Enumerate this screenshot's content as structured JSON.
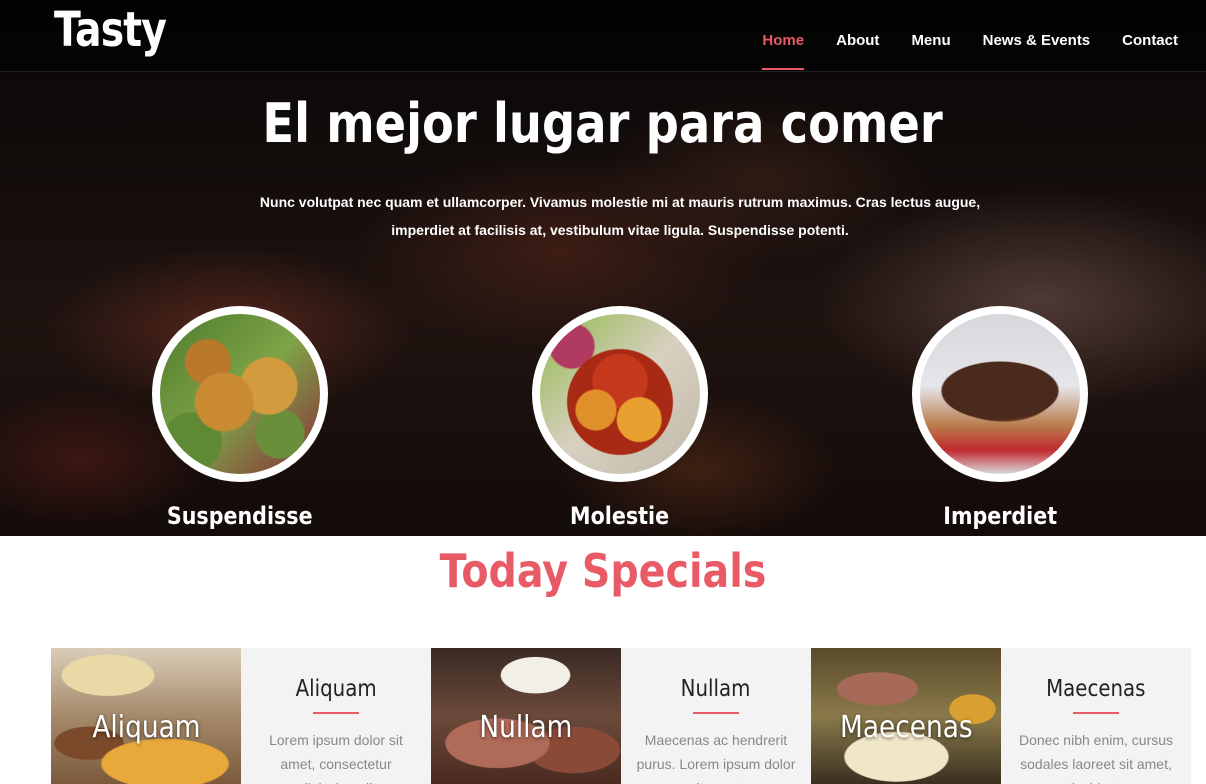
{
  "header": {
    "logo": "Tasty",
    "nav": [
      {
        "label": "Home",
        "active": true
      },
      {
        "label": "About",
        "active": false
      },
      {
        "label": "Menu",
        "active": false
      },
      {
        "label": "News & Events",
        "active": false
      },
      {
        "label": "Contact",
        "active": false
      }
    ]
  },
  "hero": {
    "title": "El mejor lugar para comer",
    "text": "Nunc volutpat nec quam et ullamcorper. Vivamus molestie mi at mauris rutrum maximus. Cras lectus augue, imperdiet at facilisis at, vestibulum vitae ligula. Suspendisse potenti.",
    "features": [
      {
        "label": "Suspendisse",
        "image": "fried-chicken"
      },
      {
        "label": "Molestie",
        "image": "chicken-stew"
      },
      {
        "label": "Imperdiet",
        "image": "grilled-steak"
      }
    ]
  },
  "specials": {
    "title": "Today Specials",
    "items": [
      {
        "image_caption": "Aliquam",
        "name": "Aliquam",
        "desc": "Lorem ipsum dolor sit amet, consectetur adipiscing elit."
      },
      {
        "image_caption": "Nullam",
        "name": "Nullam",
        "desc": "Maecenas ac hendrerit purus. Lorem ipsum dolor sit amet."
      },
      {
        "image_caption": "Maecenas",
        "name": "Maecenas",
        "desc": "Donec nibh enim, cursus sodales laoreet sit amet, tincidunt."
      }
    ]
  },
  "colors": {
    "accent": "#e85a66",
    "card_bg": "#f3f3f3"
  }
}
